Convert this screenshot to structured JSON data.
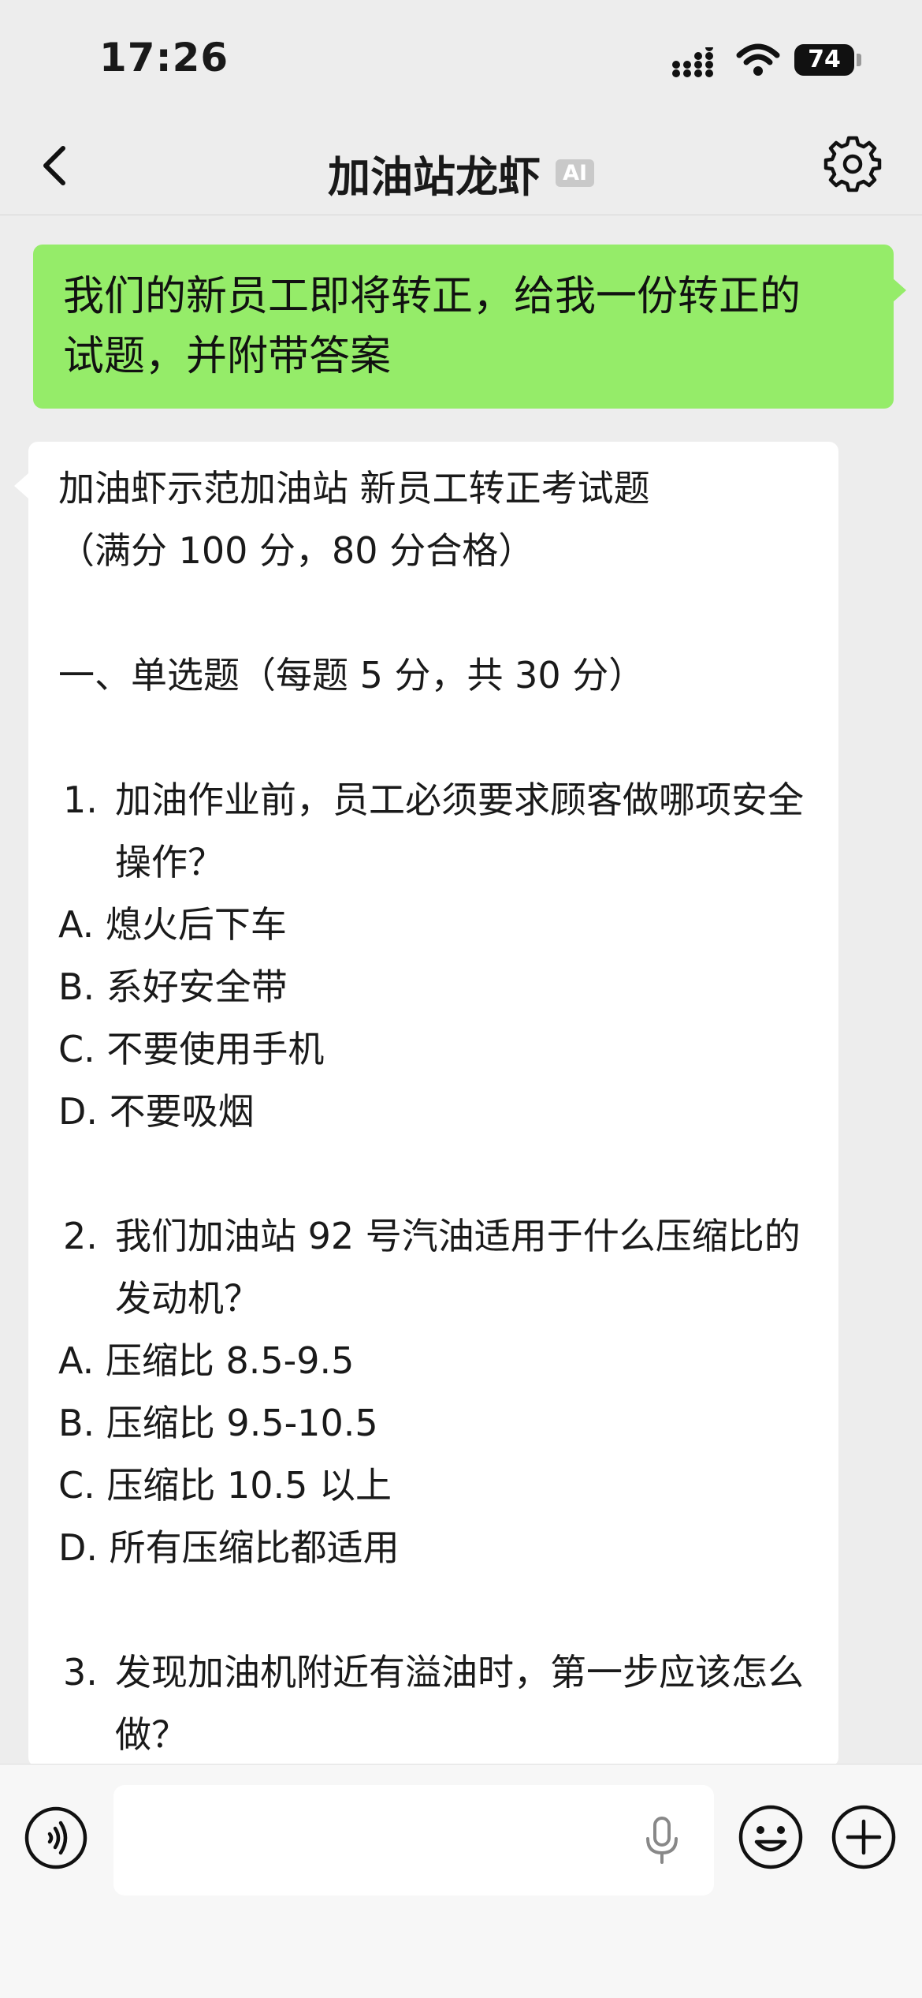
{
  "status_bar": {
    "time": "17:26",
    "battery": "74"
  },
  "nav": {
    "title": "加油站龙虾",
    "badge": "AI"
  },
  "user_message": {
    "line1": "我们的新员工即将转正，给我一份转正的",
    "line2": "试题，并附带答案"
  },
  "bot_message": {
    "title_line1": "加油虾示范加油站 新员工转正考试题",
    "title_line2": "（满分 100 分，80 分合格）",
    "section1": "一、单选题（每题 5 分，共 30 分）",
    "questions": [
      {
        "num": "1.",
        "text": "加油作业前，员工必须要求顾客做哪项安全操作？",
        "options": [
          "A. 熄火后下车",
          "B. 系好安全带",
          "C. 不要使用手机",
          "D. 不要吸烟"
        ]
      },
      {
        "num": "2.",
        "text": "我们加油站 92 号汽油适用于什么压缩比的发动机？",
        "options": [
          "A. 压缩比 8.5-9.5",
          "B. 压缩比 9.5-10.5",
          "C. 压缩比 10.5 以上",
          "D. 所有压缩比都适用"
        ]
      },
      {
        "num": "3.",
        "text": "发现加油机附近有溢油时，第一步应该怎么做？"
      }
    ]
  },
  "input": {
    "placeholder": ""
  },
  "colors": {
    "user_bubble": "#95ec69",
    "background": "#ededed",
    "badge": "#c9c9c9"
  }
}
